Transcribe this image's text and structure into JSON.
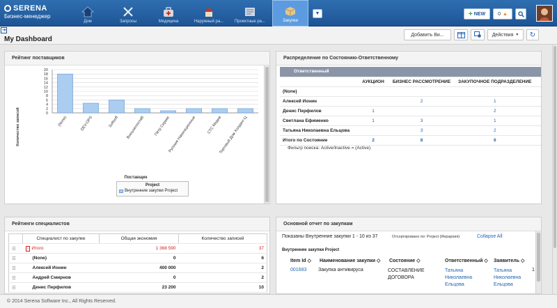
{
  "header": {
    "brand": "SERENA",
    "subtitle": "Бизнес-менеджер",
    "nav": [
      {
        "label": "Дом",
        "icon": "home-icon"
      },
      {
        "label": "Запросы",
        "icon": "tools-icon"
      },
      {
        "label": "Медицина",
        "icon": "medical-bag-icon"
      },
      {
        "label": "Наружный ра...",
        "icon": "house-icon"
      },
      {
        "label": "Проектные ра...",
        "icon": "projects-icon"
      },
      {
        "label": "Закупки",
        "icon": "purchases-icon"
      }
    ],
    "new_label": "NEW",
    "alert_count": "0"
  },
  "toolbar": {
    "title": "My Dashboard",
    "add_widget": "Добавить Ви...",
    "actions": "Действия"
  },
  "panel1": {
    "title": "Рейтинг поставщиков",
    "legend_title": "Project",
    "legend_item": "Внутренние закупки Project"
  },
  "chart_data": {
    "type": "bar",
    "categories": [
      "(None)",
      "DEV-OPS",
      "Softsoft",
      "ВнешнепостаВ",
      "Пётр Сервис",
      "Русские Навигационные Технологии",
      "СТС Медиа",
      "Торговый Дом Холдинг-Центр"
    ],
    "values": [
      18,
      4.5,
      6,
      2,
      1,
      2,
      2,
      2
    ],
    "ylabel": "Количество записей",
    "xlabel": "Поставщик",
    "yticks": [
      0,
      2,
      4,
      6,
      8,
      10,
      12,
      14,
      16,
      18,
      20
    ],
    "ylim": [
      0,
      20
    ],
    "grid": true,
    "color": "#aacdf0"
  },
  "panel2": {
    "title": "Распределение по Состоянию-Ответственному",
    "corner": "Ответственный",
    "cols": [
      "АУКЦИОН",
      "БИЗНЕС РАССМОТРЕНИЕ",
      "ЗАКУПОЧНОЕ ПОДРАЗДЕЛЕНИЕ"
    ],
    "rows": [
      {
        "name": "(None)",
        "v": [
          "",
          "",
          ""
        ]
      },
      {
        "name": "Алексей Ионин",
        "v": [
          "",
          "2",
          "1"
        ]
      },
      {
        "name": "Денис Перфилов",
        "v": [
          "1",
          "",
          "2"
        ]
      },
      {
        "name": "Светлана Ефименко",
        "v": [
          "1",
          "3",
          "1"
        ]
      },
      {
        "name": "Татьяна Николаевна Ельцова",
        "v": [
          "",
          "3",
          "2"
        ]
      },
      {
        "name": "Итого по Состояние",
        "v": [
          "2",
          "8",
          "6"
        ]
      }
    ],
    "filter": "Фильтр поиска: Active/Inactive = (Active)"
  },
  "panel3": {
    "title": "Рейтинги специалистов",
    "headers": [
      "Специалист по закупке",
      "Общая экономия",
      "Количество записей"
    ],
    "rows": [
      {
        "name": "Итого",
        "economy": "1 368 590",
        "count": "37",
        "total": true
      },
      {
        "name": "(None)",
        "economy": "0",
        "count": "6"
      },
      {
        "name": "Алексей Ионин",
        "economy": "400 000",
        "count": "2"
      },
      {
        "name": "Андрей Смирнов",
        "economy": "0",
        "count": "2"
      },
      {
        "name": "Денис Перфилов",
        "economy": "23 200",
        "count": "10"
      }
    ]
  },
  "panel4": {
    "title": "Основной отчет по закупкам",
    "shown": "Показаны Внутренние закупки 1 - 10 из 37",
    "sorted": "Отсортировано по: Project (Иерархия)",
    "collapse": "Collapse All",
    "group": "Внутренние закупки Project",
    "headers": [
      "Item Id",
      "Наименование закупки",
      "Состояние",
      "Ответственный",
      "Заявитель"
    ],
    "row": {
      "id": "001683",
      "name": "Закупка антивируса",
      "state": "СОСТАВЛЕНИЕ ДОГОВОРА",
      "owner": "Татьяна Николаевна Ельцова",
      "requester": "Татьяна Николаевна Ельцова",
      "extra": "1"
    }
  },
  "footer": {
    "copyright": "© 2014 Serena Software Inc., All Rights Reserved."
  }
}
